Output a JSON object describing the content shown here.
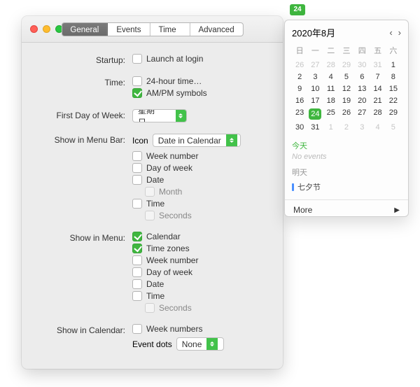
{
  "prefs": {
    "tabs": [
      "General",
      "Events",
      "Time Zones",
      "Advanced"
    ],
    "active_tab": 0,
    "labels": {
      "startup": "Startup:",
      "time": "Time:",
      "first_day": "First Day of Week:",
      "menubar": "Show in Menu Bar:",
      "menu": "Show in Menu:",
      "calendar": "Show in Calendar:"
    },
    "startup": {
      "launch_at_login": {
        "label": "Launch at login",
        "checked": false
      }
    },
    "time": {
      "twenty_four": {
        "label": "24-hour time…",
        "checked": false
      },
      "ampm": {
        "label": "AM/PM symbols",
        "checked": true
      }
    },
    "first_day_select": "星期日…",
    "menubar": {
      "icon_label": "Icon",
      "icon_select": "Date in Calendar",
      "items": [
        {
          "label": "Week number",
          "checked": false
        },
        {
          "label": "Day of week",
          "checked": false
        },
        {
          "label": "Date",
          "checked": false
        },
        {
          "label": "Month",
          "checked": false,
          "indent": true
        },
        {
          "label": "Time",
          "checked": false
        },
        {
          "label": "Seconds",
          "checked": false,
          "indent": true
        }
      ]
    },
    "menu": {
      "items": [
        {
          "label": "Calendar",
          "checked": true
        },
        {
          "label": "Time zones",
          "checked": true
        },
        {
          "label": "Week number",
          "checked": false
        },
        {
          "label": "Day of week",
          "checked": false
        },
        {
          "label": "Date",
          "checked": false
        },
        {
          "label": "Time",
          "checked": false
        },
        {
          "label": "Seconds",
          "checked": false,
          "indent": true
        }
      ]
    },
    "calendar": {
      "week_numbers": {
        "label": "Week numbers",
        "checked": false
      },
      "event_dots_label": "Event dots",
      "event_dots_select": "None"
    }
  },
  "menubar_badge": "24",
  "popover": {
    "title": "2020年8月",
    "dow": [
      "日",
      "一",
      "二",
      "三",
      "四",
      "五",
      "六"
    ],
    "days": [
      {
        "n": 26,
        "out": true
      },
      {
        "n": 27,
        "out": true
      },
      {
        "n": 28,
        "out": true
      },
      {
        "n": 29,
        "out": true
      },
      {
        "n": 30,
        "out": true
      },
      {
        "n": 31,
        "out": true
      },
      {
        "n": 1
      },
      {
        "n": 2
      },
      {
        "n": 3
      },
      {
        "n": 4
      },
      {
        "n": 5
      },
      {
        "n": 6
      },
      {
        "n": 7
      },
      {
        "n": 8
      },
      {
        "n": 9
      },
      {
        "n": 10
      },
      {
        "n": 11
      },
      {
        "n": 12
      },
      {
        "n": 13
      },
      {
        "n": 14
      },
      {
        "n": 15
      },
      {
        "n": 16
      },
      {
        "n": 17
      },
      {
        "n": 18
      },
      {
        "n": 19
      },
      {
        "n": 20
      },
      {
        "n": 21
      },
      {
        "n": 22
      },
      {
        "n": 23
      },
      {
        "n": 24,
        "today": true
      },
      {
        "n": 25
      },
      {
        "n": 26
      },
      {
        "n": 27
      },
      {
        "n": 28
      },
      {
        "n": 29
      },
      {
        "n": 30
      },
      {
        "n": 31
      },
      {
        "n": 1,
        "out": true
      },
      {
        "n": 2,
        "out": true
      },
      {
        "n": 3,
        "out": true
      },
      {
        "n": 4,
        "out": true
      },
      {
        "n": 5,
        "out": true
      }
    ],
    "today_label": "今天",
    "no_events": "No events",
    "tomorrow_label": "明天",
    "event": "七夕节",
    "more": "More"
  }
}
